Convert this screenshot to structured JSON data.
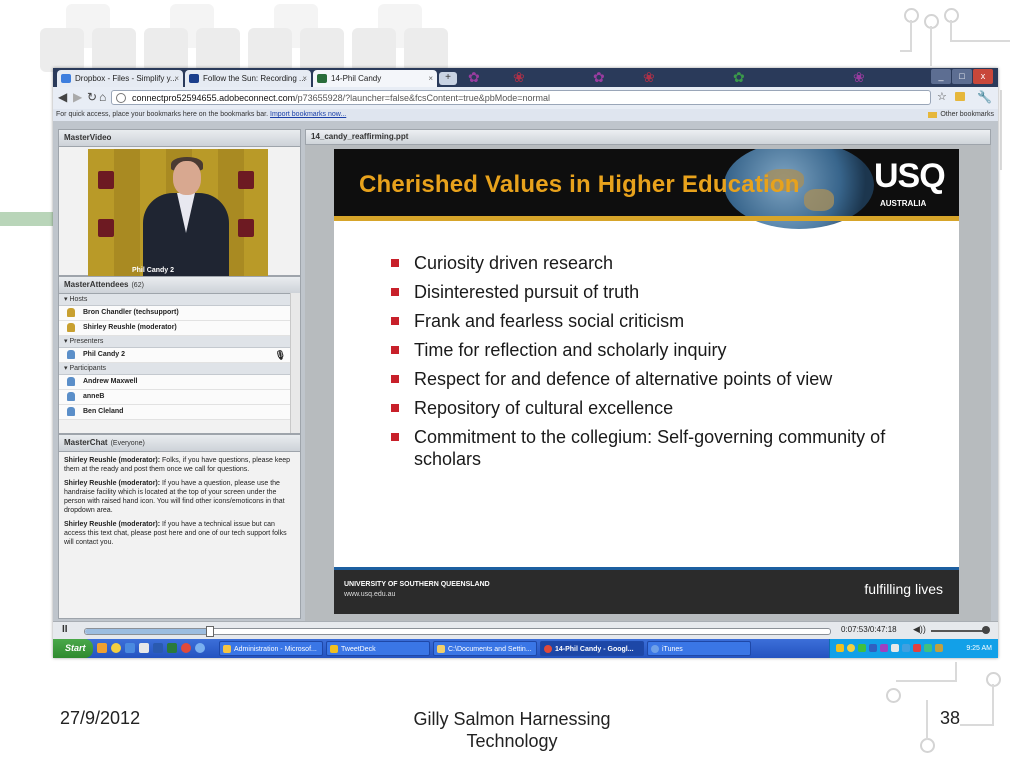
{
  "browser": {
    "tabs": [
      {
        "label": "Dropbox - Files - Simplify y...",
        "icon_color": "#3d7ede",
        "active": false
      },
      {
        "label": "Follow the Sun: Recording ...",
        "icon_color": "#1b3f8c",
        "active": false
      },
      {
        "label": "14-Phil Candy",
        "icon_color": "#2a6d3a",
        "active": true
      }
    ],
    "new_tab_label": "+",
    "url_host": "connectpro52594655.adobeconnect.com",
    "url_path": "/p73655928/?launcher=false&fcsContent=true&pbMode=normal",
    "bookmarks_text": "For quick access, place your bookmarks here on the bookmarks bar.",
    "import_link": "Import bookmarks now...",
    "other_bookmarks": "Other bookmarks",
    "window_buttons": {
      "minimize": "_",
      "maximize": "□",
      "close": "x"
    }
  },
  "video": {
    "title": "MasterVideo",
    "caption": "Phil Candy 2"
  },
  "attendees": {
    "title": "MasterAttendees",
    "count": "(62)",
    "sections": [
      {
        "label": "Hosts",
        "rows": [
          {
            "name": "Bron Chandler (techsupport)",
            "icon_color": "#c8a030"
          },
          {
            "name": "Shirley Reushle (moderator)",
            "icon_color": "#c8a030"
          }
        ]
      },
      {
        "label": "Presenters",
        "rows": [
          {
            "name": "Phil Candy 2",
            "icon_color": "#5b8fc9"
          }
        ]
      },
      {
        "label": "Participants",
        "rows": [
          {
            "name": "Andrew Maxwell",
            "icon_color": "#5b8fc9"
          },
          {
            "name": "anneB",
            "icon_color": "#5b8fc9"
          },
          {
            "name": "Ben Cleland",
            "icon_color": "#5b8fc9"
          }
        ]
      }
    ]
  },
  "chat": {
    "title": "MasterChat",
    "scope": "(Everyone)",
    "messages": [
      {
        "sender": "Shirley Reushle (moderator):",
        "text": "Folks, if you have questions, please keep them at the ready and post them once we call for questions."
      },
      {
        "sender": "Shirley Reushle (moderator):",
        "text": "If you have a question, please use the handraise facility which is located at the top of your screen under the person with raised hand icon. You will find other icons/emoticons in that dropdown area."
      },
      {
        "sender": "Shirley Reushle (moderator):",
        "text": "If you have a technical issue but can access this text chat, please post here and one of our tech support folks will contact you."
      }
    ]
  },
  "share": {
    "filename": "14_candy_reaffirming.ppt",
    "slide": {
      "title": "Cherished Values in Higher Education",
      "logo": "USQ",
      "logo_sub": "AUSTRALIA",
      "bullets": [
        "Curiosity driven research",
        "Disinterested pursuit of truth",
        "Frank and fearless social criticism",
        "Time for reflection and scholarly inquiry",
        "Respect for and defence of alternative points of view",
        "Repository of cultural excellence",
        "Commitment to the collegium: Self-governing community of scholars"
      ],
      "footer_university": "UNIVERSITY OF SOUTHERN QUEENSLAND",
      "footer_url": "www.usq.edu.au",
      "footer_tagline": "fulfilling lives"
    }
  },
  "playback": {
    "pause_label": "II",
    "time": "0:07:53/0:47:18",
    "progress_fraction": 0.167,
    "volume_icon": "◀))"
  },
  "taskbar": {
    "start_label": "Start",
    "tasks": [
      {
        "label": "Administration - Microsof...",
        "icon_color": "#f5c542",
        "active": false
      },
      {
        "label": "TweetDeck",
        "icon_color": "#f0c020",
        "active": false
      },
      {
        "label": "C:\\Documents and Settin...",
        "icon_color": "#f2d06b",
        "active": false
      },
      {
        "label": "14-Phil Candy - Googl...",
        "icon_color": "#e04a3a",
        "active": true
      },
      {
        "label": "iTunes",
        "icon_color": "#6ea0e8",
        "active": false
      }
    ],
    "clock": "9:25 AM"
  },
  "page_footer": {
    "date": "27/9/2012",
    "center_line1": "Gilly Salmon Harnessing",
    "center_line2": "Technology",
    "page_number": "38"
  },
  "colors": {
    "slide_title": "#e8a21c",
    "bullet": "#c8202a",
    "taskbar": "#2453c0"
  }
}
